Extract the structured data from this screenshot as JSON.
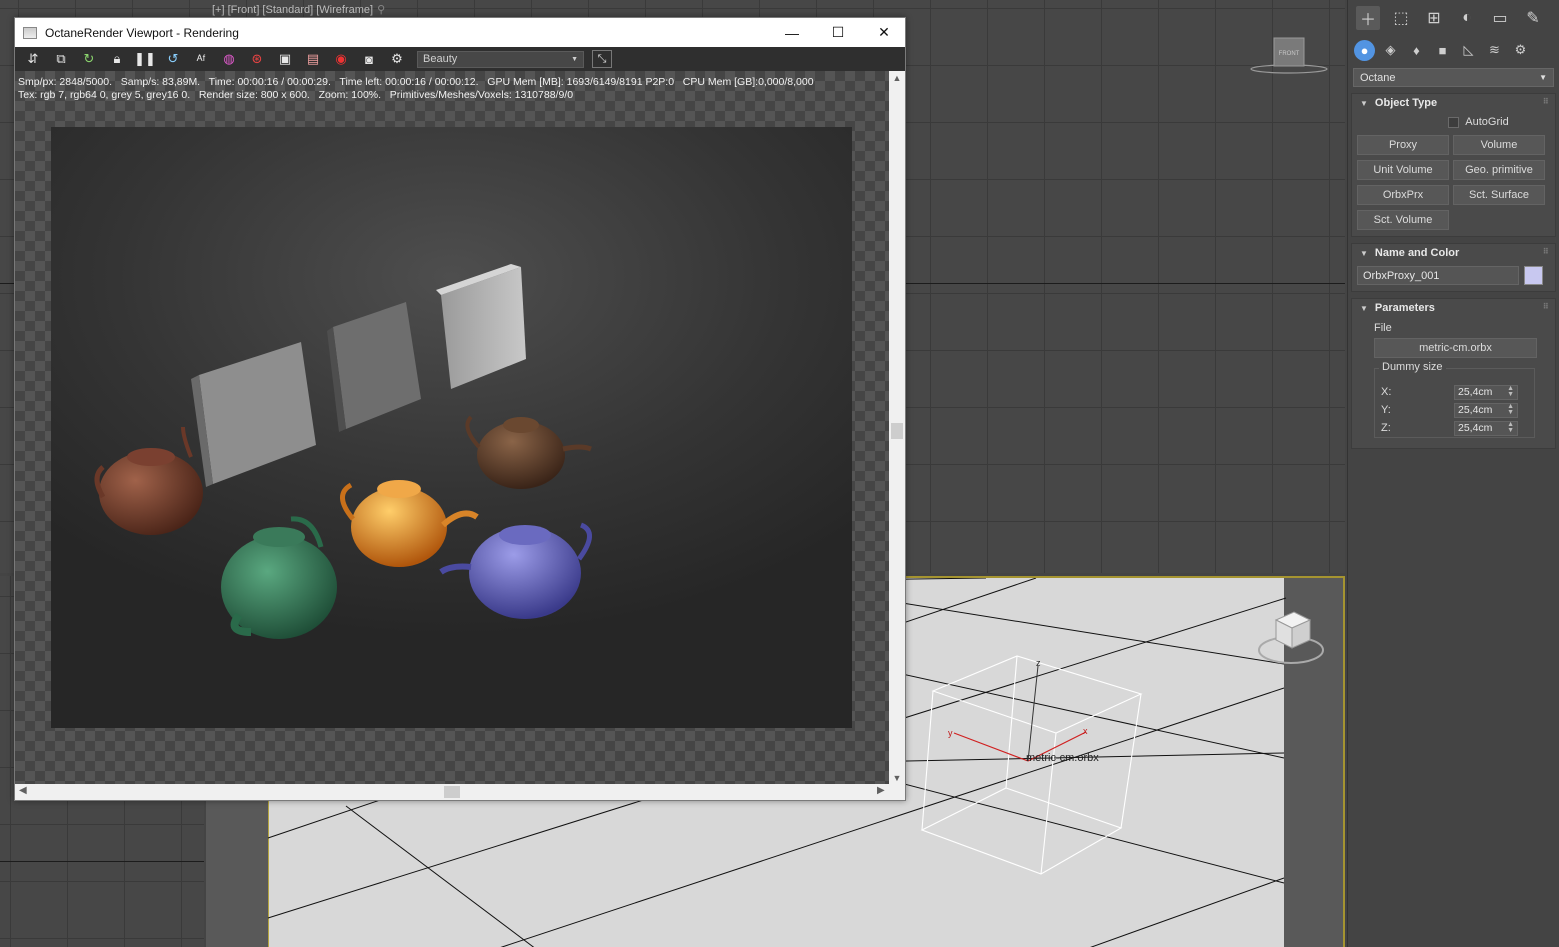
{
  "front_viewport": {
    "label": "[+] [Front] [Standard] [Wireframe]",
    "viewcube_label": "FRONT"
  },
  "perspective_viewport": {
    "object_label": "metric-cm.orbx",
    "axis_labels": {
      "x": "x",
      "y": "y",
      "z": "z"
    }
  },
  "render_window": {
    "title": "OctaneRender Viewport - Rendering",
    "controls": {
      "minimize": "—",
      "maximize": "☐",
      "close": "✕"
    },
    "pass_select": "Beauty",
    "stats_line1": "Smp/px: 2848/5000.   Samp/s: 83,89M.   Time: 00:00:16 / 00:00:29.   Time left: 00:00:16 / 00:00:12.   GPU Mem [MB]: 1693/6149/8191 P2P:0   CPU Mem [GB]:0,000/8,000",
    "stats_line2": "Tex: rgb 7, rgb64 0, grey 5, grey16 0.   Render size: 800 x 600.   Zoom: 100%.   Primitives/Meshes/Voxels: 1310788/9/0"
  },
  "command_panel": {
    "category_dropdown": "Octane",
    "object_type": {
      "title": "Object Type",
      "autogrid": "AutoGrid",
      "buttons": [
        "Proxy",
        "Volume",
        "Unit Volume",
        "Geo. primitive",
        "OrbxPrx",
        "Sct. Surface",
        "Sct. Volume"
      ]
    },
    "name_and_color": {
      "title": "Name and Color",
      "name": "OrbxProxy_001",
      "color": "#c8c8f0"
    },
    "parameters": {
      "title": "Parameters",
      "file_label": "File",
      "file_button": "metric-cm.orbx",
      "dummy_size_title": "Dummy size",
      "x_label": "X:",
      "x_value": "25,4cm",
      "y_label": "Y:",
      "y_value": "25,4cm",
      "z_label": "Z:",
      "z_value": "25,4cm"
    }
  },
  "colors": {
    "active_viewport_border": "#a59430",
    "accent_blue": "#5294e2"
  }
}
